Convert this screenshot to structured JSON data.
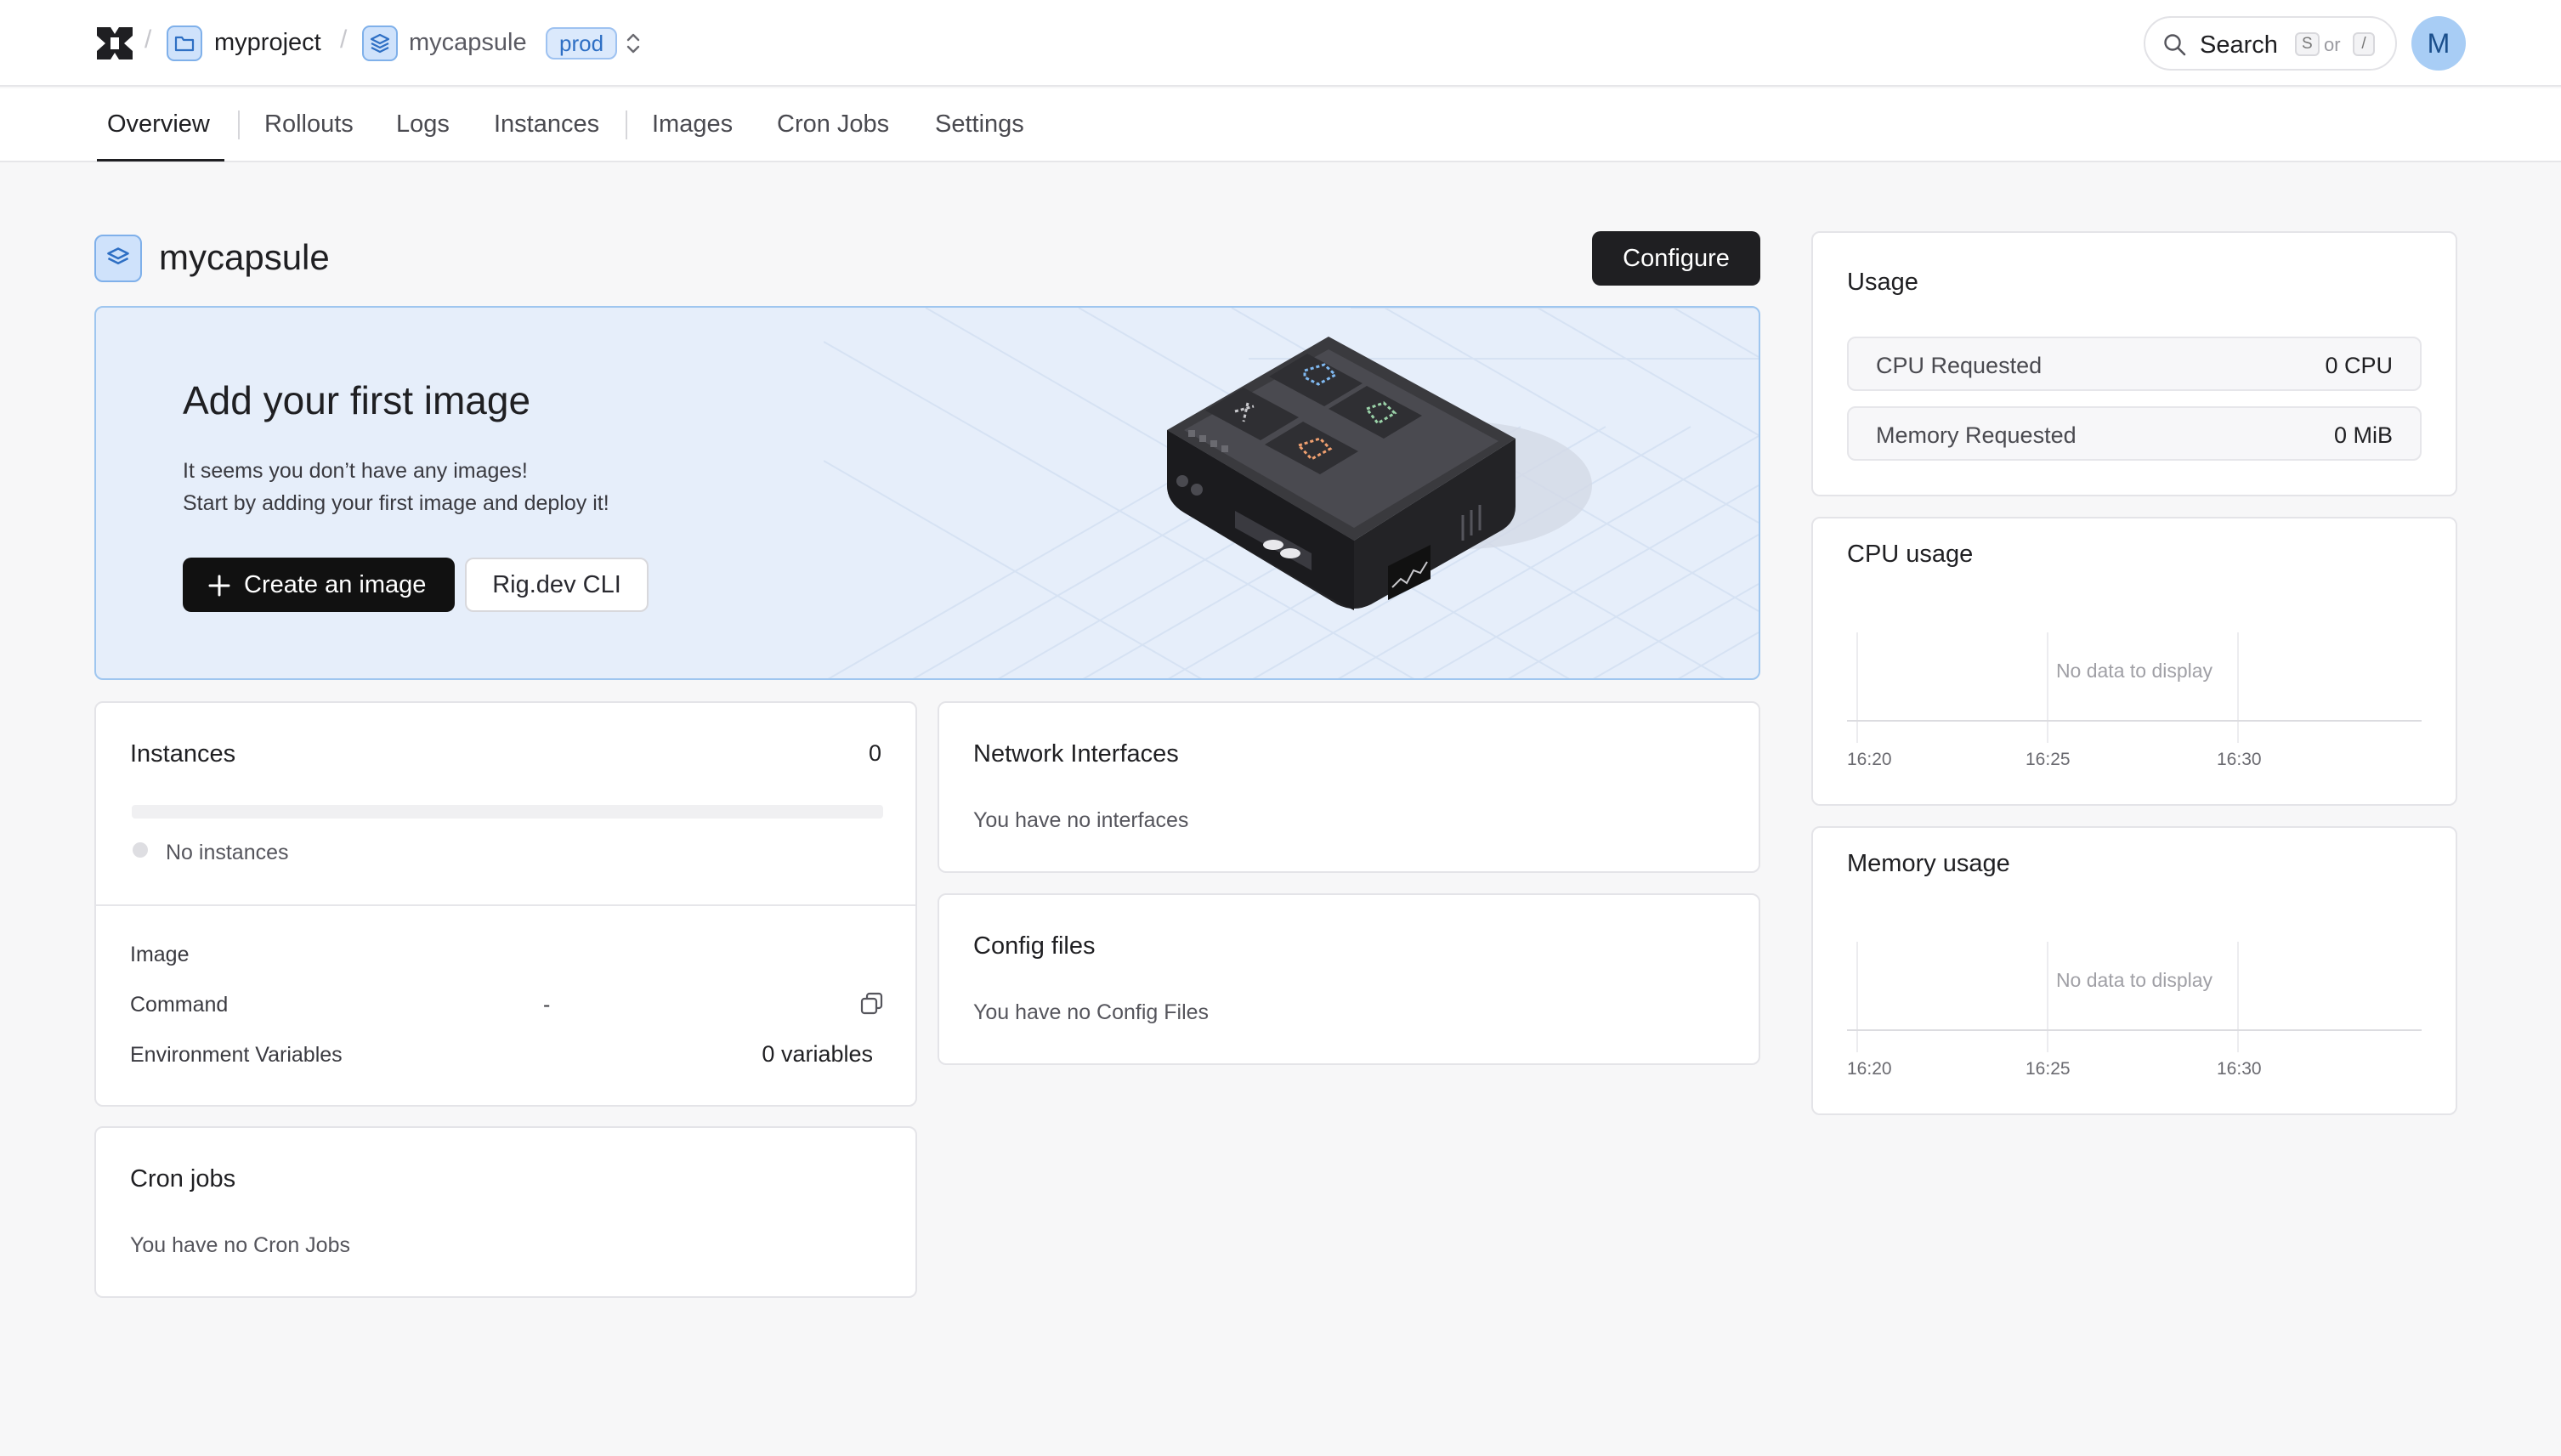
{
  "breadcrumb": {
    "project": "myproject",
    "capsule": "mycapsule",
    "environment": "prod"
  },
  "search": {
    "label": "Search",
    "shortcut_key": "S",
    "or_text": "or",
    "alt_key": "/"
  },
  "user": {
    "avatar_initial": "M"
  },
  "tabs": [
    {
      "label": "Overview",
      "active": true
    },
    {
      "label": "Rollouts"
    },
    {
      "label": "Logs"
    },
    {
      "label": "Instances"
    },
    {
      "label": "Images"
    },
    {
      "label": "Cron Jobs"
    },
    {
      "label": "Settings"
    }
  ],
  "page": {
    "title": "mycapsule",
    "configure_label": "Configure"
  },
  "hero": {
    "title": "Add your first image",
    "line1": "It seems you don’t have any images!",
    "line2": "Start by adding your first image and deploy it!",
    "create_label": "Create an image",
    "cli_label": "Rig.dev CLI"
  },
  "instances": {
    "title": "Instances",
    "count": "0",
    "status": "No instances",
    "image_label": "Image",
    "command_label": "Command",
    "command_value": "-",
    "env_label": "Environment Variables",
    "env_value": "0 variables"
  },
  "network": {
    "title": "Network Interfaces",
    "empty": "You have no interfaces"
  },
  "config_files": {
    "title": "Config files",
    "empty": "You have no Config Files"
  },
  "cron": {
    "title": "Cron jobs",
    "empty": "You have no Cron Jobs"
  },
  "usage": {
    "title": "Usage",
    "cpu_label": "CPU Requested",
    "cpu_value": "0 CPU",
    "mem_label": "Memory Requested",
    "mem_value": "0 MiB"
  },
  "cpu_chart": {
    "title": "CPU usage",
    "empty": "No data to display",
    "ticks": [
      "16:20",
      "16:25",
      "16:30"
    ]
  },
  "mem_chart": {
    "title": "Memory usage",
    "empty": "No data to display",
    "ticks": [
      "16:20",
      "16:25",
      "16:30"
    ]
  },
  "colors": {
    "accent": "#2e6fc4",
    "hero_bg": "#e6eefa",
    "button_dark": "#111111"
  }
}
